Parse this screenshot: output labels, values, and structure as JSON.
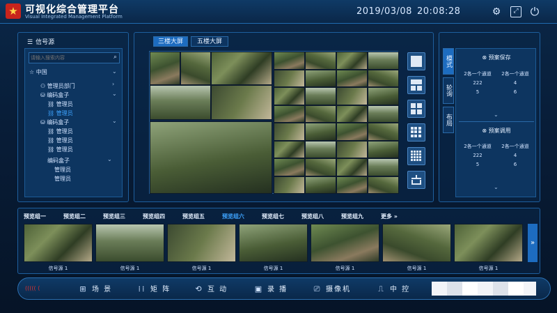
{
  "header": {
    "title": "可视化综合管理平台",
    "subtitle": "Visual Integrated Management Platform",
    "date": "2019/03/08",
    "time": "20:08:28",
    "logo_icon": "star-emblem-icon",
    "settings_icon": "gear-icon",
    "screen_icon": "fullscreen-icon",
    "power_icon": "power-icon"
  },
  "left_panel": {
    "title": "信号源",
    "search_placeholder": "请输入搜索内容",
    "tree": [
      {
        "label": "中国",
        "icon": "star-icon"
      },
      {
        "label": "管理员部门",
        "icon": "group-icon"
      },
      {
        "label": "编码盒子",
        "icon": "db-icon"
      },
      {
        "label": "管理员",
        "icon": "link-icon"
      },
      {
        "label": "管理员",
        "icon": "link-icon",
        "selected": true
      },
      {
        "label": "编码盒子",
        "icon": "db-icon"
      },
      {
        "label": "管理员",
        "icon": "link-icon"
      },
      {
        "label": "管理员",
        "icon": "link-icon"
      },
      {
        "label": "管理员",
        "icon": "link-icon"
      },
      {
        "label": "编码盒子",
        "icon": "db-icon"
      },
      {
        "label": "管理员"
      },
      {
        "label": "管理员"
      }
    ]
  },
  "center_panel": {
    "tabs": [
      "三楼大屏",
      "五楼大屏"
    ],
    "active_tab": 0,
    "layout_buttons": [
      "layout-1x1",
      "layout-1+2",
      "layout-2x2",
      "layout-3x3",
      "layout-4x4",
      "layout-custom"
    ]
  },
  "right_panel": {
    "vtabs": [
      "模式",
      "轮询",
      "布局"
    ],
    "save": {
      "title": "预案保存",
      "cols": [
        "2各一个通道",
        "2各一个通道"
      ],
      "rows": [
        [
          "222",
          "4"
        ],
        [
          "5",
          "6"
        ]
      ]
    },
    "call": {
      "title": "预案调用",
      "cols": [
        "2各一个通道",
        "2各一个通道"
      ],
      "rows": [
        [
          "222",
          "4"
        ],
        [
          "5",
          "6"
        ]
      ]
    }
  },
  "bottom": {
    "groups": [
      "预览组一",
      "预览组二",
      "预览组三",
      "预览组四",
      "预览组五",
      "预览组六",
      "预览组七",
      "预览组八",
      "预览组九",
      "更多"
    ],
    "active_group": 5,
    "more_icon": "double-chevron-right-icon",
    "thumbs": [
      {
        "label": "信号源 1"
      },
      {
        "label": "信号源 1"
      },
      {
        "label": "信号源 1"
      },
      {
        "label": "信号源 1"
      },
      {
        "label": "信号源 1"
      },
      {
        "label": "信号源 1"
      },
      {
        "label": "信号源 1"
      }
    ]
  },
  "nav": {
    "items": [
      {
        "label": "场 景",
        "icon": "grid-icon"
      },
      {
        "label": "矩 阵",
        "icon": "matrix-icon"
      },
      {
        "label": "互 动",
        "icon": "interaction-icon"
      },
      {
        "label": "录 播",
        "icon": "record-icon"
      },
      {
        "label": "摄像机",
        "icon": "camera-icon"
      },
      {
        "label": "中 控",
        "icon": "monitor-icon"
      }
    ]
  },
  "colors": {
    "accent": "#1d6cc0",
    "highlight": "#3ea4ff",
    "background": "#081d38",
    "logo_red": "#c8241c"
  }
}
